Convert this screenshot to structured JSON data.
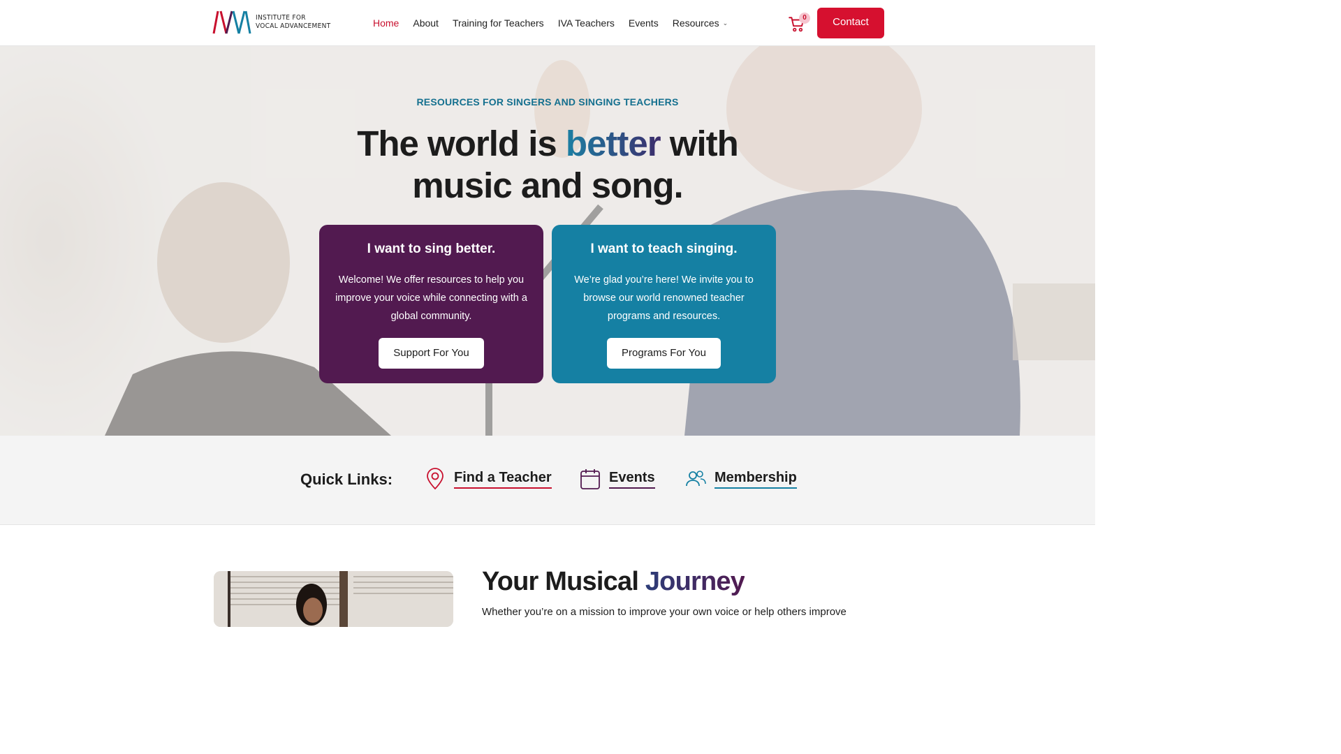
{
  "header": {
    "logo_line1": "INSTITUTE FOR",
    "logo_line2": "VOCAL ADVANCEMENT",
    "nav": [
      {
        "label": "Home",
        "active": true
      },
      {
        "label": "About"
      },
      {
        "label": "Training for Teachers"
      },
      {
        "label": "IVA Teachers"
      },
      {
        "label": "Events"
      },
      {
        "label": "Resources",
        "has_dropdown": true
      }
    ],
    "cart_count": "0",
    "contact_label": "Contact"
  },
  "hero": {
    "eyebrow": "RESOURCES FOR SINGERS AND SINGING TEACHERS",
    "headline_part1": "The world is ",
    "headline_accent": "better",
    "headline_part2": " with",
    "headline_line2": "music and song.",
    "cards": [
      {
        "title": "I want to sing better.",
        "body": "Welcome! We offer resources to help you improve your voice while connecting with a global community.",
        "button": "Support For You"
      },
      {
        "title": "I want to teach singing.",
        "body": "We’re glad you’re here! We invite you to browse our world renowned teacher programs and resources.",
        "button": "Programs For You"
      }
    ]
  },
  "quick_links": {
    "title": "Quick Links:",
    "items": [
      {
        "label": "Find a Teacher",
        "icon": "map-pin-icon"
      },
      {
        "label": "Events",
        "icon": "calendar-icon"
      },
      {
        "label": "Membership",
        "icon": "users-icon"
      }
    ]
  },
  "journey": {
    "title_part1": "Your Musical ",
    "title_accent": "Journey",
    "text": "Whether you’re on a mission to improve your own voice or help others improve"
  },
  "colors": {
    "brand_red": "#d6102f",
    "purple": "#521a50",
    "teal": "#1580a3"
  }
}
